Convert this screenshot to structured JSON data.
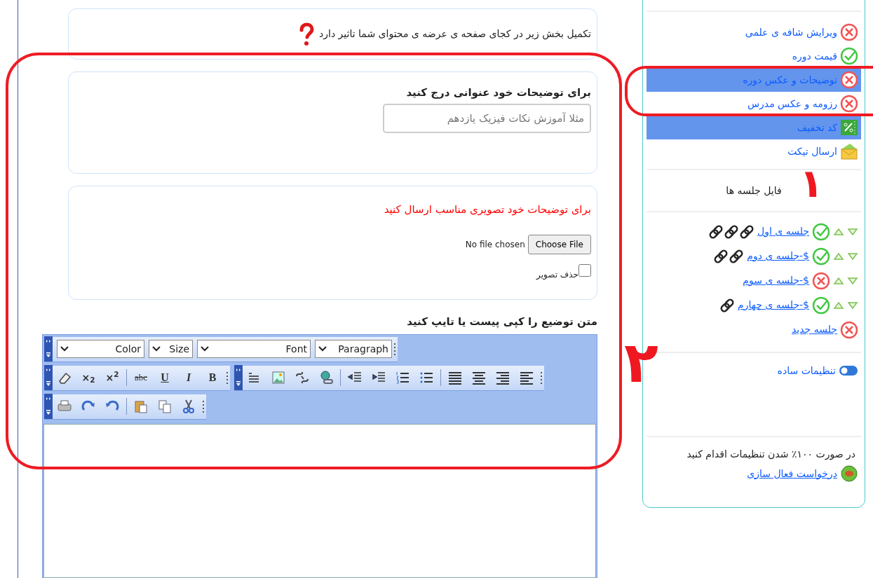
{
  "notice": {
    "text": "تکمیل بخش زیر در کجای صفحه ی عرضه ی محتوای شما تاثیر دارد"
  },
  "title_section": {
    "label": "برای توضیحات خود عنوانی درج کنید",
    "placeholder": "مثلا آموزش نکات فیزیک یازدهم"
  },
  "image_section": {
    "label": "برای توضیحات خود تصویری مناسب ارسال کنید",
    "file_status": "No file chosen",
    "file_button": "Choose File",
    "delete_label": "حذف تصویر",
    "delete_checked": false
  },
  "editor": {
    "label": "متن توضیع را کپی پیست یا تایپ کنید",
    "toolbars": [
      [
        {
          "items": [
            {
              "kind": "select",
              "label": "Paragraph"
            },
            {
              "kind": "select",
              "label": "Font"
            },
            {
              "kind": "select",
              "label": "Size"
            },
            {
              "kind": "select",
              "label": "Color"
            }
          ]
        }
      ],
      [
        {
          "items": [
            {
              "kind": "icon"
            },
            {
              "kind": "icon"
            },
            {
              "kind": "icon"
            },
            {
              "kind": "icon"
            },
            {
              "kind": "sep"
            },
            {
              "kind": "icon"
            },
            {
              "kind": "icon"
            },
            {
              "kind": "icon"
            },
            {
              "kind": "icon"
            },
            {
              "kind": "sep"
            },
            {
              "kind": "icon"
            },
            {
              "kind": "icon"
            },
            {
              "kind": "icon"
            },
            {
              "kind": "icon"
            }
          ]
        },
        {
          "items": [
            {
              "kind": "bold",
              "label": "B"
            },
            {
              "kind": "italic",
              "label": "I"
            },
            {
              "kind": "underline",
              "label": "U"
            },
            {
              "kind": "strike",
              "label": "abc"
            },
            {
              "kind": "sep"
            },
            {
              "kind": "script",
              "label": "×$^{2}$"
            },
            {
              "kind": "script",
              "label": "×$_{2}$"
            },
            {
              "kind": "icon"
            }
          ]
        }
      ],
      [
        {
          "items": [
            {
              "kind": "icon"
            },
            {
              "kind": "icon"
            },
            {
              "kind": "icon"
            },
            {
              "kind": "sep"
            },
            {
              "kind": "icon"
            },
            {
              "kind": "icon"
            },
            {
              "kind": "icon"
            }
          ]
        }
      ]
    ]
  },
  "sidebar": {
    "items": [
      {
        "kind": "step",
        "label": "ویرایش شافه ی علمی",
        "done": false,
        "selected": false
      },
      {
        "kind": "step",
        "label": "قیمت دوره",
        "done": true,
        "selected": false
      },
      {
        "kind": "step",
        "label": "توضیحات و عکس دوره",
        "done": false,
        "selected": true
      },
      {
        "kind": "step",
        "label": "رزومه و عکس مدرس",
        "done": false,
        "selected": false
      },
      {
        "kind": "discount",
        "label": "کد تخفیف",
        "selected": true
      },
      {
        "kind": "ticket",
        "label": "ارسال تیکت",
        "selected": false
      }
    ],
    "sessions_heading": "فایل جلسه ها",
    "sessions": [
      {
        "kind": "session",
        "label": "جلسه ی اول",
        "done": true,
        "attachments": [
          {
            "kind": "link"
          },
          {
            "kind": "link"
          },
          {
            "kind": "link"
          }
        ]
      },
      {
        "kind": "session",
        "label": "$-جلسه ی دوم",
        "done": true,
        "attachments": [
          {
            "kind": "link"
          },
          {
            "kind": "link"
          }
        ]
      },
      {
        "kind": "session",
        "label": "$-جلسه ی سوم",
        "done": false
      },
      {
        "kind": "session",
        "label": "$-جلسه ی چهارم",
        "done": true,
        "attachments": [
          {
            "kind": "link"
          }
        ]
      },
      {
        "kind": "new",
        "label": "جلسه جدید",
        "done": false
      }
    ],
    "simple_settings": {
      "label": "تنظیمات ساده",
      "on": true
    },
    "footer_text": "در صورت ۱۰۰٪ شدن تنظیمات اقدام کنید",
    "activation_link": "درخواست فعال سازی"
  },
  "annotations": [
    {
      "text": "۱"
    },
    {
      "text": "۲"
    }
  ]
}
